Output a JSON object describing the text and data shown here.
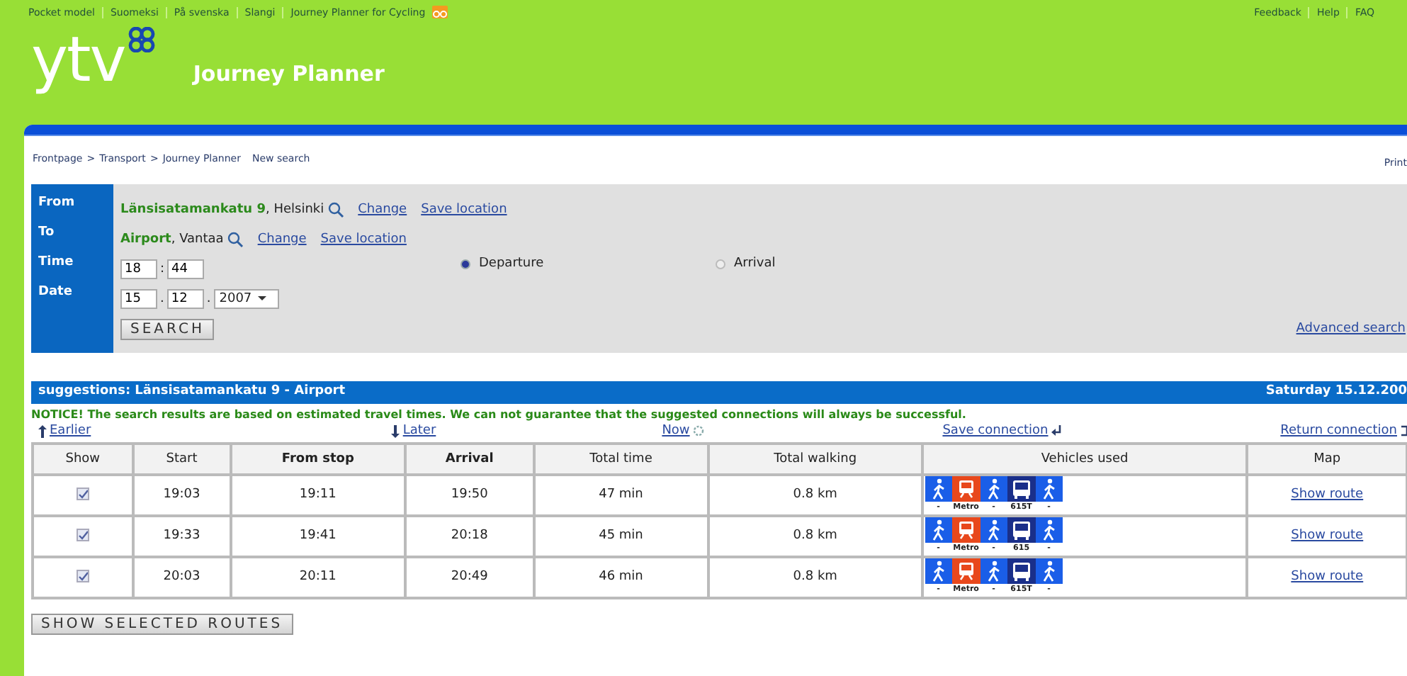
{
  "top_links": [
    "Pocket model",
    "Suomeksi",
    "På svenska",
    "Slangi",
    "Journey Planner for Cycling"
  ],
  "right_links": [
    "Feedback",
    "Help",
    "FAQ"
  ],
  "logo": "ytv",
  "title": "Journey Planner",
  "breadcrumb": [
    "Frontpage",
    "Transport",
    "Journey Planner"
  ],
  "breadcrumb_separator": ">",
  "new_search": "New search",
  "print": "Print",
  "form": {
    "rows": [
      {
        "kind": "place",
        "label": "From",
        "place": "**Länsisatamankatu 9**, Helsinki",
        "change": "Change",
        "save": "Save location"
      },
      {
        "kind": "place",
        "label": "To",
        "place": "**Airport**, Vantaa",
        "change": "Change",
        "save": "Save location"
      },
      {
        "kind": "time",
        "label": "Time",
        "values": [
          "18",
          "44"
        ],
        "separators": [
          ":"
        ]
      },
      {
        "kind": "date",
        "label": "Date",
        "values": [
          "15",
          "12",
          "2007"
        ],
        "separators": [
          ".",
          "."
        ]
      }
    ],
    "radios": [
      {
        "label": "Departure",
        "selected": true
      },
      {
        "label": "Arrival",
        "selected": false
      }
    ],
    "search_button": "SEARCH",
    "advanced": "Advanced search"
  },
  "results": {
    "title": "suggestions: Länsisatamankatu 9 - Airport",
    "date": "Saturday 15.12.200",
    "notice": "NOTICE! The search results are based on estimated travel times. We can not guarantee that the suggested connections will always be successful.",
    "nav": [
      {
        "kind": "earlier",
        "label": "Earlier"
      },
      {
        "kind": "later",
        "label": "Later"
      },
      {
        "kind": "now",
        "label": "Now"
      },
      {
        "kind": "save",
        "label": "Save connection"
      },
      {
        "kind": "return",
        "label": "Return connection"
      }
    ],
    "columns": [
      "Show",
      "Start",
      "From stop",
      "Arrival",
      "Total time",
      "Total walking",
      "Vehicles used",
      "Map"
    ],
    "rows": [
      {
        "checked": true,
        "start": "19:03",
        "from_stop": "19:11",
        "arrival": "19:50",
        "total_time": "47 min",
        "walking": "0.8 km",
        "legs": [
          {
            "kind": "walk",
            "label": "-"
          },
          {
            "kind": "metro",
            "label": "Metro"
          },
          {
            "kind": "walk",
            "label": "-"
          },
          {
            "kind": "bus",
            "label": "615T"
          },
          {
            "kind": "walk",
            "label": "-"
          }
        ],
        "map": "Show route"
      },
      {
        "checked": true,
        "start": "19:33",
        "from_stop": "19:41",
        "arrival": "20:18",
        "total_time": "45 min",
        "walking": "0.8 km",
        "legs": [
          {
            "kind": "walk",
            "label": "-"
          },
          {
            "kind": "metro",
            "label": "Metro"
          },
          {
            "kind": "walk",
            "label": "-"
          },
          {
            "kind": "bus",
            "label": "615"
          },
          {
            "kind": "walk",
            "label": "-"
          }
        ],
        "map": "Show route"
      },
      {
        "checked": true,
        "start": "20:03",
        "from_stop": "20:11",
        "arrival": "20:49",
        "total_time": "46 min",
        "walking": "0.8 km",
        "legs": [
          {
            "kind": "walk",
            "label": "-"
          },
          {
            "kind": "metro",
            "label": "Metro"
          },
          {
            "kind": "walk",
            "label": "-"
          },
          {
            "kind": "bus",
            "label": "615T"
          },
          {
            "kind": "walk",
            "label": "-"
          }
        ],
        "map": "Show route"
      }
    ],
    "show_button": "SHOW SELECTED ROUTES"
  }
}
